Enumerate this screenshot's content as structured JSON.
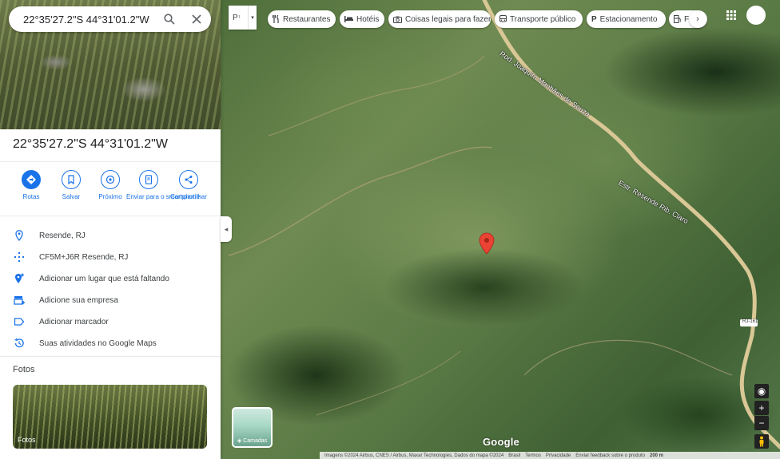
{
  "search": {
    "value": "22°35'27.2\"S 44°31'01.2\"W"
  },
  "panel": {
    "title": "22°35'27.2\"S 44°31'01.2\"W",
    "actions": [
      {
        "label": "Rotas",
        "icon": "directions-icon"
      },
      {
        "label": "Salvar",
        "icon": "bookmark-icon"
      },
      {
        "label": "Próximo",
        "icon": "nearby-icon"
      },
      {
        "label": "Enviar para o smartphone",
        "icon": "send-to-phone-icon"
      },
      {
        "label": "Compartilhar",
        "icon": "share-icon"
      }
    ],
    "info": [
      {
        "text": "Resende, RJ",
        "icon": "location-pin-icon"
      },
      {
        "text": "CF5M+J6R Resende, RJ",
        "icon": "plus-code-icon"
      },
      {
        "text": "Adicionar um lugar que está faltando",
        "icon": "add-place-icon"
      },
      {
        "text": "Adicione sua empresa",
        "icon": "business-icon"
      },
      {
        "text": "Adicionar marcador",
        "icon": "label-icon"
      },
      {
        "text": "Suas atividades no Google Maps",
        "icon": "history-icon"
      }
    ],
    "photos_heading": "Fotos",
    "photos_caption": "Fotos"
  },
  "topbar": {
    "partial_label": "P",
    "chips": [
      "Restaurantes",
      "Hotéis",
      "Coisas legais para fazer",
      "Transporte público",
      "Estacionamento",
      "Fa"
    ]
  },
  "map": {
    "roads": [
      {
        "label": "Rod. Joaquim Manhães de Souza"
      },
      {
        "label": "Estr. Resende Rib. Claro"
      },
      {
        "label": "RJ-161"
      }
    ],
    "layers_label": "Camadas",
    "google_logo": "Google",
    "footer": [
      "Imagens ©2024 Airbus, CNES / Airbus, Maxar Technologies, Dados do mapa ©2024",
      "Brasil",
      "Termos",
      "Privacidade",
      "Enviar feedback sobre o produto",
      "200 m"
    ]
  }
}
